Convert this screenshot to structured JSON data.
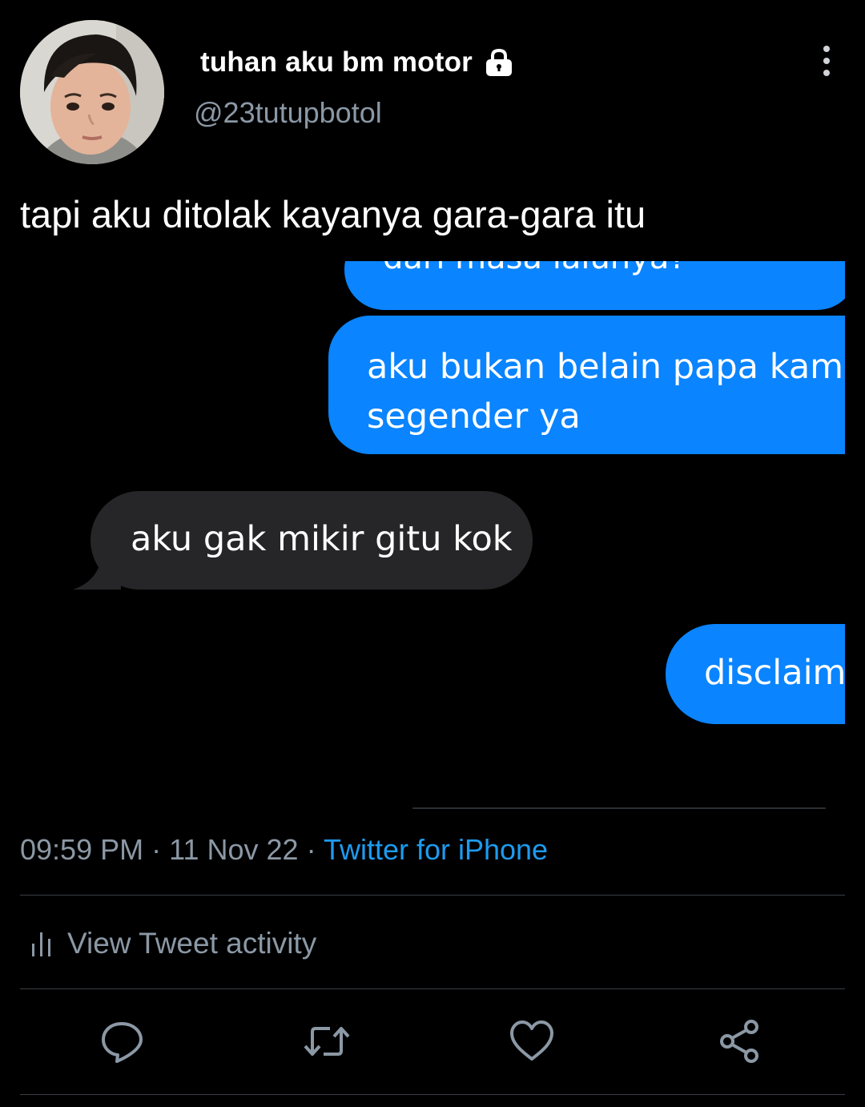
{
  "tweet": {
    "author": {
      "display_name": "tuhan aku bm motor",
      "handle": "@23tutupbotol",
      "protected_icon": "lock-icon"
    },
    "text": "tapi aku ditolak kayanya gara-gara itu",
    "time": "09:59 PM",
    "separator": "·",
    "date": "11 Nov 22",
    "source": "Twitter for iPhone"
  },
  "media": {
    "messages": [
      {
        "side": "sent",
        "text": "dari masa lalunya?"
      },
      {
        "side": "sent",
        "text": "aku bukan belain papa kamu\nsegender ya"
      },
      {
        "side": "received",
        "text": "aku gak mikir gitu kok"
      },
      {
        "side": "sent",
        "text": "disclaim"
      }
    ],
    "colors": {
      "sent": "#0a84ff",
      "received": "#262629"
    }
  },
  "activity": {
    "label": "View Tweet activity",
    "icon": "bar-chart-icon"
  },
  "actions": [
    {
      "name": "reply",
      "icon": "reply-icon"
    },
    {
      "name": "retweet",
      "icon": "retweet-icon"
    },
    {
      "name": "like",
      "icon": "heart-icon"
    },
    {
      "name": "share",
      "icon": "share-icon"
    }
  ],
  "colors": {
    "background": "#000000",
    "primary_text": "#ffffff",
    "secondary_text": "#8b98a5",
    "link": "#1d9bf0"
  }
}
